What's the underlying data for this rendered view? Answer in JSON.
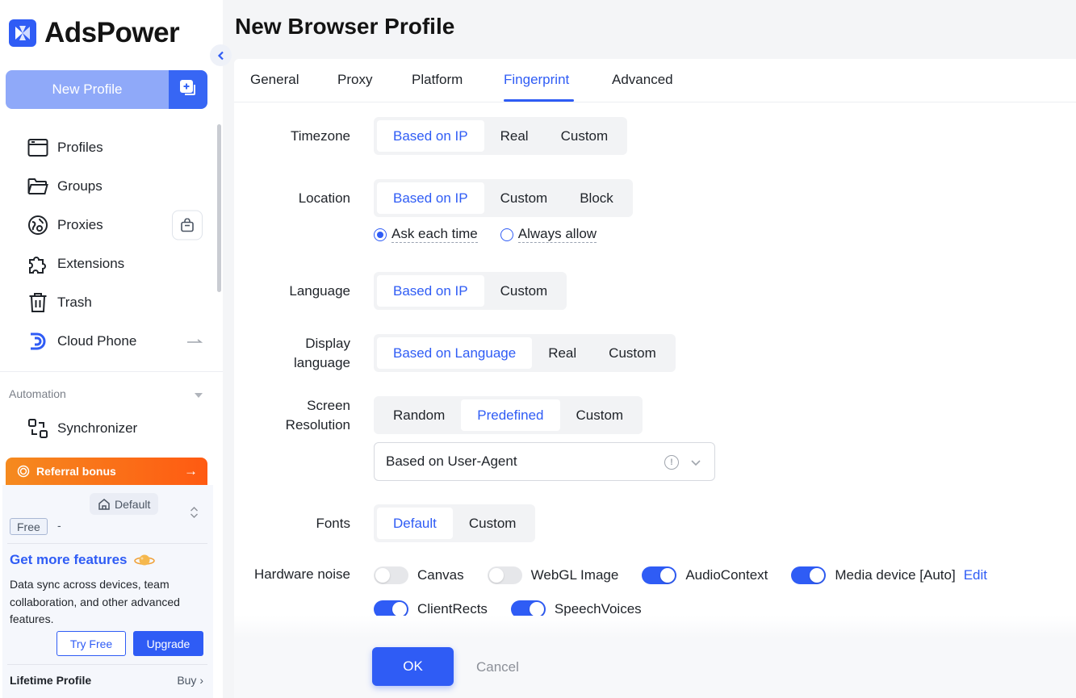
{
  "app": {
    "name": "AdsPower",
    "brand_color": "#2f5cf5"
  },
  "sidebar": {
    "new_profile_label": "New Profile",
    "items": [
      {
        "label": "Profiles",
        "icon": "browser-window-icon"
      },
      {
        "label": "Groups",
        "icon": "folder-icon"
      },
      {
        "label": "Proxies",
        "icon": "globe-pin-icon"
      },
      {
        "label": "Extensions",
        "icon": "puzzle-icon"
      },
      {
        "label": "Trash",
        "icon": "trash-icon"
      },
      {
        "label": "Cloud Phone",
        "icon": "cloud-phone-icon"
      }
    ],
    "automation_label": "Automation",
    "synchronizer_label": "Synchronizer",
    "referral_label": "Referral bonus",
    "referral_arrow": "→",
    "plan": {
      "workspace": "Default",
      "tier": "Free",
      "tier_suffix": "-",
      "promo_title": "Get more features",
      "promo_desc": "Data sync across devices, team collaboration, and other advanced features.",
      "try_free_label": "Try Free",
      "upgrade_label": "Upgrade",
      "lifetime_label": "Lifetime Profile",
      "buy_label": "Buy ›"
    }
  },
  "main": {
    "title": "New Browser Profile",
    "tabs": [
      "General",
      "Proxy",
      "Platform",
      "Fingerprint",
      "Advanced"
    ],
    "active_tab": "Fingerprint",
    "timezone": {
      "label": "Timezone",
      "options": [
        "Based on IP",
        "Real",
        "Custom"
      ],
      "selected": "Based on IP"
    },
    "location": {
      "label": "Location",
      "options": [
        "Based on IP",
        "Custom",
        "Block"
      ],
      "selected": "Based on IP",
      "radio_options": [
        "Ask each time",
        "Always allow"
      ],
      "radio_selected": "Ask each time"
    },
    "language": {
      "label": "Language",
      "options": [
        "Based on IP",
        "Custom"
      ],
      "selected": "Based on IP"
    },
    "display_language": {
      "label_line1": "Display",
      "label_line2": "language",
      "options": [
        "Based on Language",
        "Real",
        "Custom"
      ],
      "selected": "Based on Language"
    },
    "screen_resolution": {
      "label_line1": "Screen",
      "label_line2": "Resolution",
      "options": [
        "Random",
        "Predefined",
        "Custom"
      ],
      "selected": "Predefined",
      "select_value": "Based on User-Agent"
    },
    "fonts": {
      "label": "Fonts",
      "options": [
        "Default",
        "Custom"
      ],
      "selected": "Default"
    },
    "hardware_noise": {
      "label": "Hardware noise",
      "items": [
        {
          "label": "Canvas",
          "on": false
        },
        {
          "label": "WebGL Image",
          "on": false
        },
        {
          "label": "AudioContext",
          "on": true
        },
        {
          "label": "Media device [Auto]",
          "on": true
        },
        {
          "label": "ClientRects",
          "on": true
        },
        {
          "label": "SpeechVoices",
          "on": true
        }
      ],
      "edit_label": "Edit"
    },
    "ok_label": "OK",
    "cancel_label": "Cancel"
  }
}
